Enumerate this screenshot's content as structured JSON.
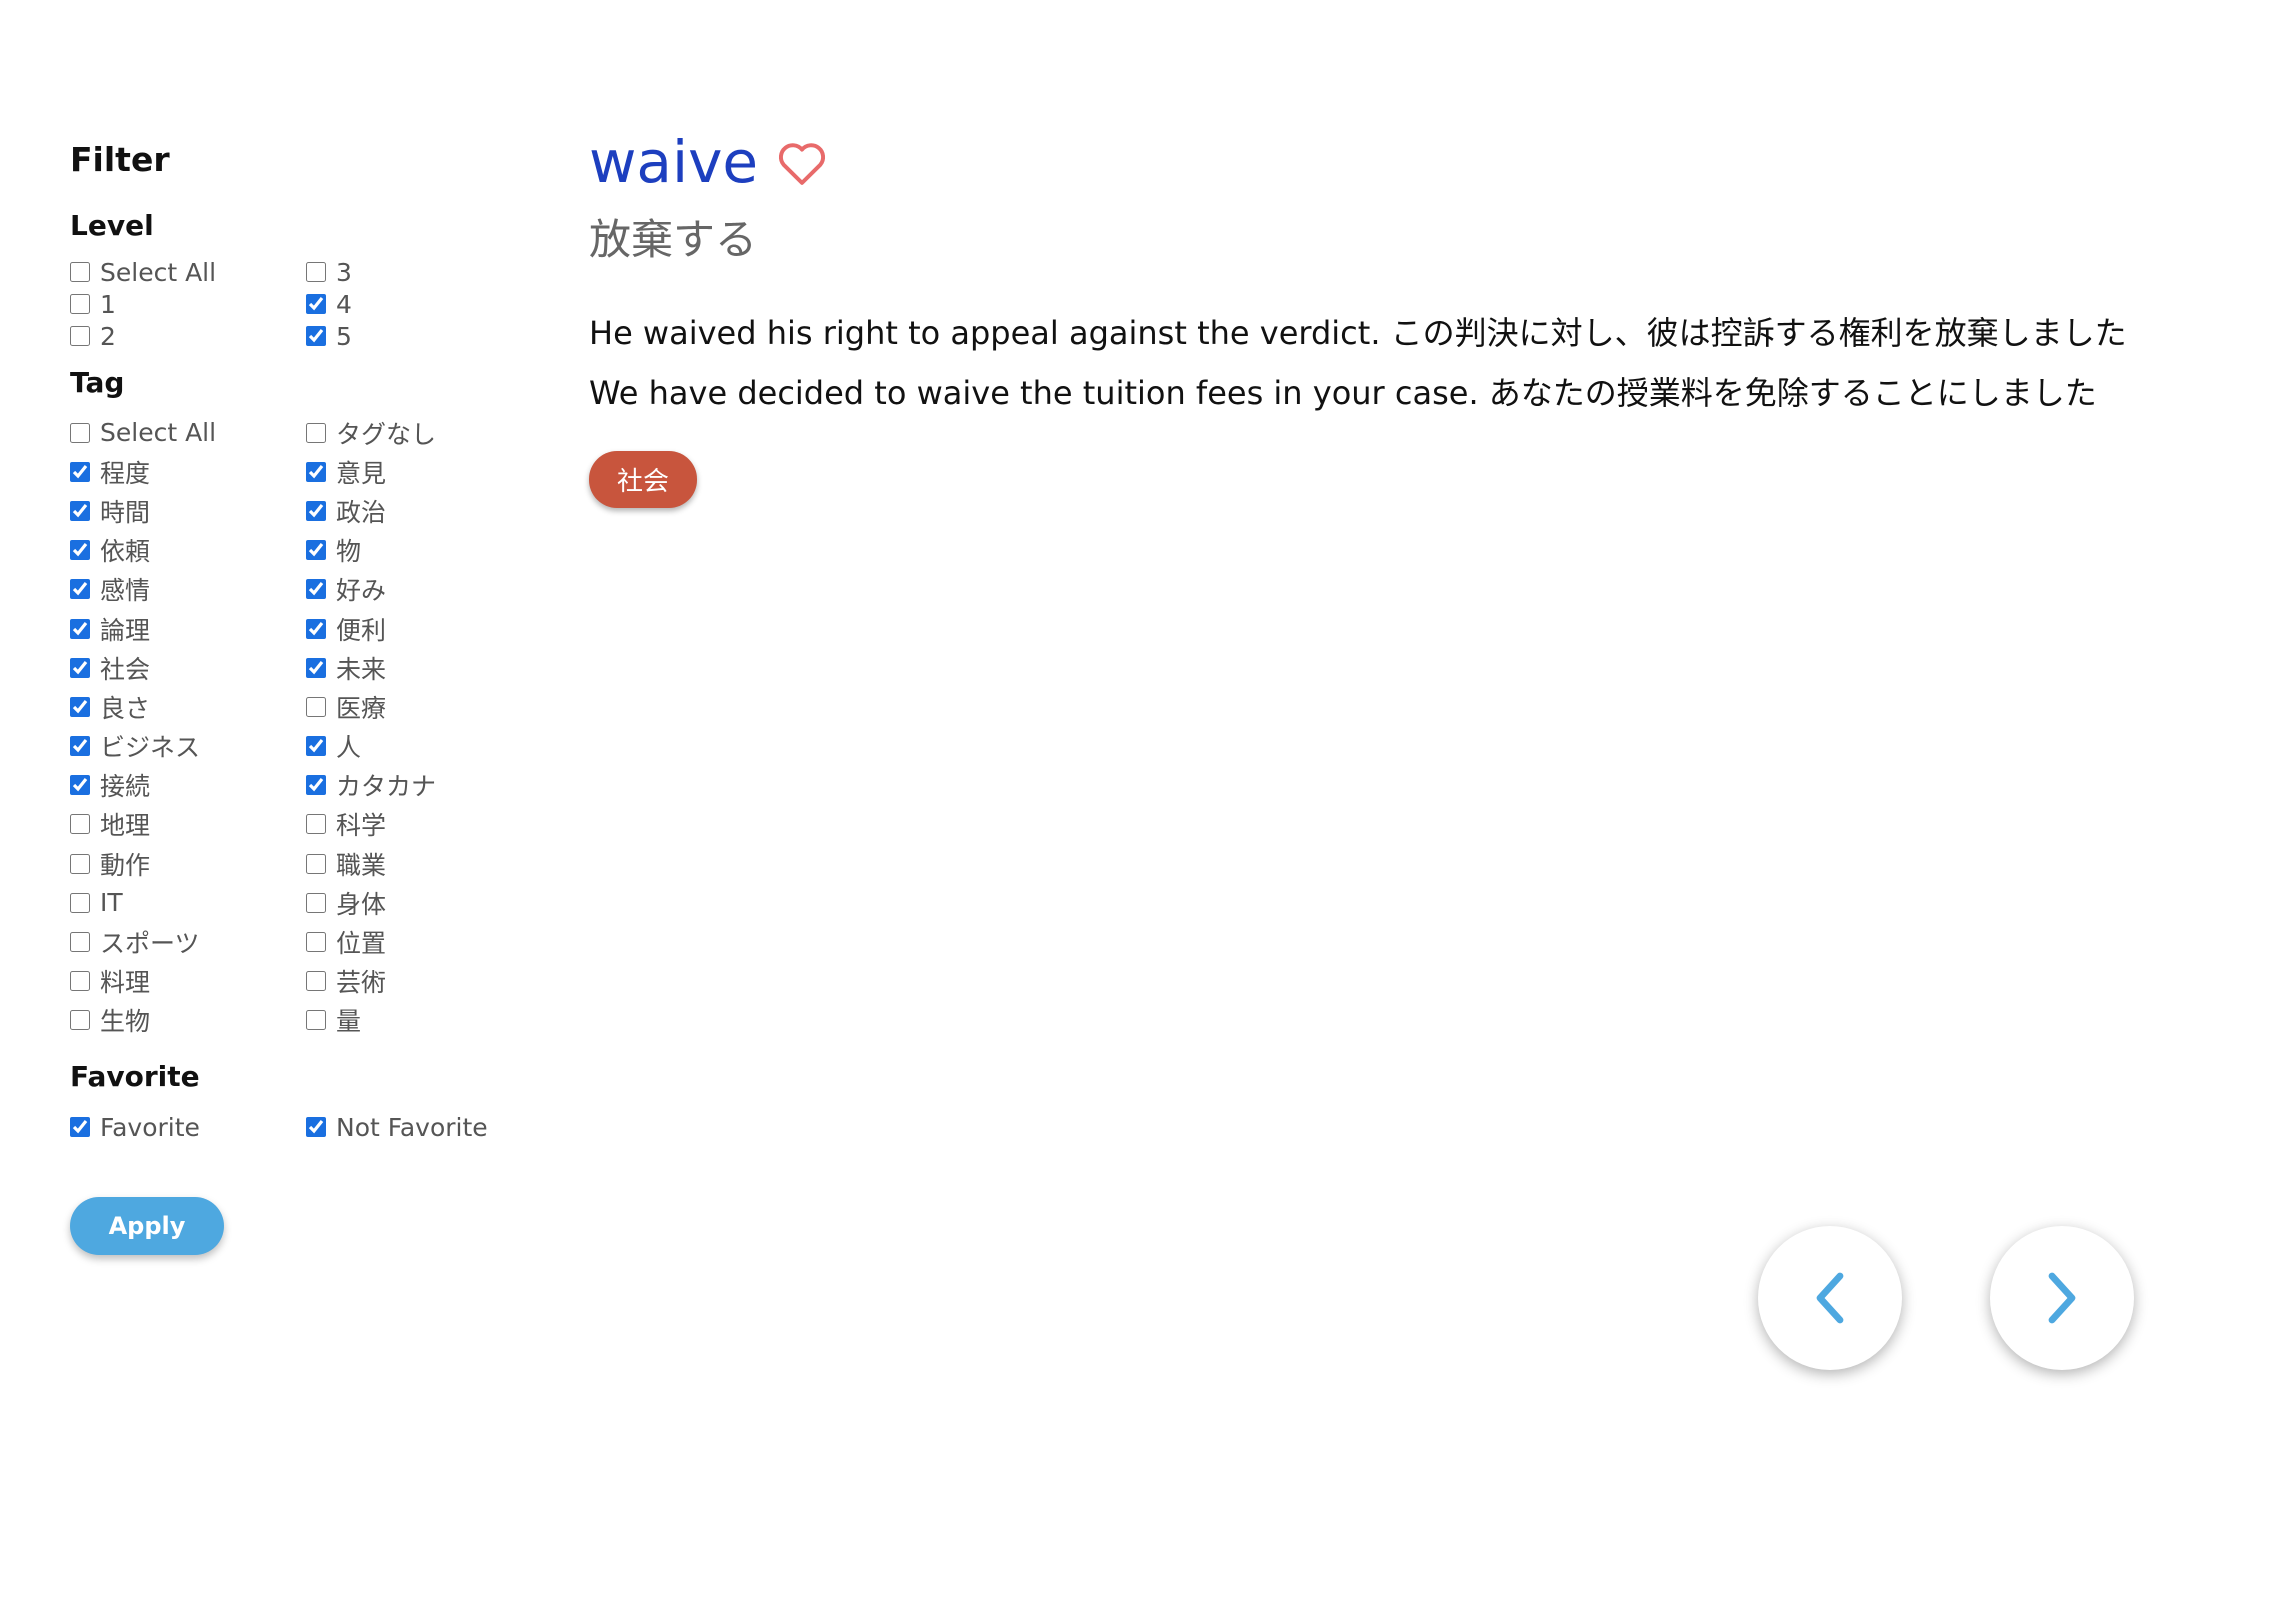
{
  "sidebar": {
    "title": "Filter",
    "level": {
      "title": "Level",
      "options": [
        {
          "label": "Select All",
          "checked": false
        },
        {
          "label": "3",
          "checked": false
        },
        {
          "label": "1",
          "checked": false
        },
        {
          "label": "4",
          "checked": true
        },
        {
          "label": "2",
          "checked": false
        },
        {
          "label": "5",
          "checked": true
        }
      ]
    },
    "tag": {
      "title": "Tag",
      "options": [
        {
          "label": "Select All",
          "checked": false
        },
        {
          "label": "タグなし",
          "checked": false
        },
        {
          "label": "程度",
          "checked": true
        },
        {
          "label": "意見",
          "checked": true
        },
        {
          "label": "時間",
          "checked": true
        },
        {
          "label": "政治",
          "checked": true
        },
        {
          "label": "依頼",
          "checked": true
        },
        {
          "label": "物",
          "checked": true
        },
        {
          "label": "感情",
          "checked": true
        },
        {
          "label": "好み",
          "checked": true
        },
        {
          "label": "論理",
          "checked": true
        },
        {
          "label": "便利",
          "checked": true
        },
        {
          "label": "社会",
          "checked": true
        },
        {
          "label": "未来",
          "checked": true
        },
        {
          "label": "良さ",
          "checked": true
        },
        {
          "label": "医療",
          "checked": false
        },
        {
          "label": "ビジネス",
          "checked": true
        },
        {
          "label": "人",
          "checked": true
        },
        {
          "label": "接続",
          "checked": true
        },
        {
          "label": "カタカナ",
          "checked": true
        },
        {
          "label": "地理",
          "checked": false
        },
        {
          "label": "科学",
          "checked": false
        },
        {
          "label": "動作",
          "checked": false
        },
        {
          "label": "職業",
          "checked": false
        },
        {
          "label": "IT",
          "checked": false
        },
        {
          "label": "身体",
          "checked": false
        },
        {
          "label": "スポーツ",
          "checked": false
        },
        {
          "label": "位置",
          "checked": false
        },
        {
          "label": "料理",
          "checked": false
        },
        {
          "label": "芸術",
          "checked": false
        },
        {
          "label": "生物",
          "checked": false
        },
        {
          "label": "量",
          "checked": false
        }
      ]
    },
    "favorite": {
      "title": "Favorite",
      "options": [
        {
          "label": "Favorite",
          "checked": true
        },
        {
          "label": "Not Favorite",
          "checked": true
        }
      ]
    },
    "apply_label": "Apply"
  },
  "main": {
    "word": "waive",
    "meaning": "放棄する",
    "sentences": [
      "He waived his right to appeal against the verdict. この判決に対し、彼は控訴する権利を放棄しました",
      "We have decided to waive the tuition fees in your case. あなたの授業料を免除することにしました"
    ],
    "tag": "社会",
    "favorite_icon": "heart-outline-icon"
  },
  "nav": {
    "prev_icon": "chevron-left-icon",
    "next_icon": "chevron-right-icon"
  },
  "colors": {
    "word": "#1d3fbf",
    "heart": "#e86a6a",
    "tag_bg": "#c8553d",
    "apply_bg": "#4ea8e0",
    "chevron": "#4ea8e0",
    "checkbox": "#1a6fe0"
  }
}
